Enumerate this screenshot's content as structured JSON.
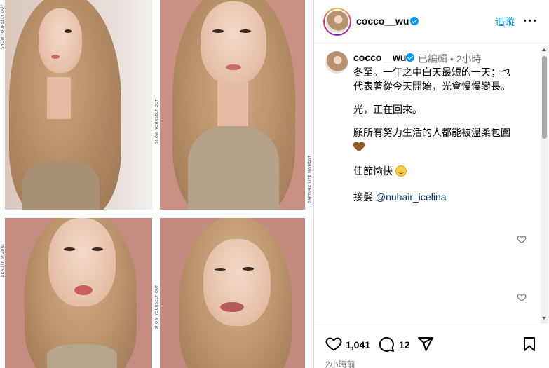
{
  "post": {
    "username": "cocco__wu",
    "follow_label": "追蹤",
    "more_label": "更多選項"
  },
  "caption": {
    "username": "cocco__wu",
    "edited_label": "已編輯",
    "separator": "•",
    "time_ago": "2小時",
    "lines": [
      "冬至。一年之中白天最短的一天；也",
      "代表著從今天開始，光會慢慢變長。",
      "光，正在回來。",
      "願所有努力生活的人都能被溫柔包圍",
      "佳節愉快",
      "接髮"
    ],
    "mention": "@nuhair_icelina",
    "heart_emoji": "brown-heart",
    "smile_emoji": "smiling-face"
  },
  "photos": {
    "side_labels": [
      "SHOW YOURSELF OUT",
      "SHOW YOURSELF OUT",
      "CAPTURE LIFE MOMENT",
      "BEAUTY STUDIO",
      "SHOW YOURSELF OUT"
    ]
  },
  "actions": {
    "like_count": "1,041",
    "comment_count": "12",
    "timestamp": "2小時前",
    "icons": [
      "heart-icon",
      "comment-icon",
      "share-icon",
      "save-icon"
    ]
  },
  "colors": {
    "accent": "#0095f6",
    "verified": "#0095f6",
    "muted": "#737373",
    "mention": "#00376b",
    "photo_bg": "#c98f83"
  }
}
